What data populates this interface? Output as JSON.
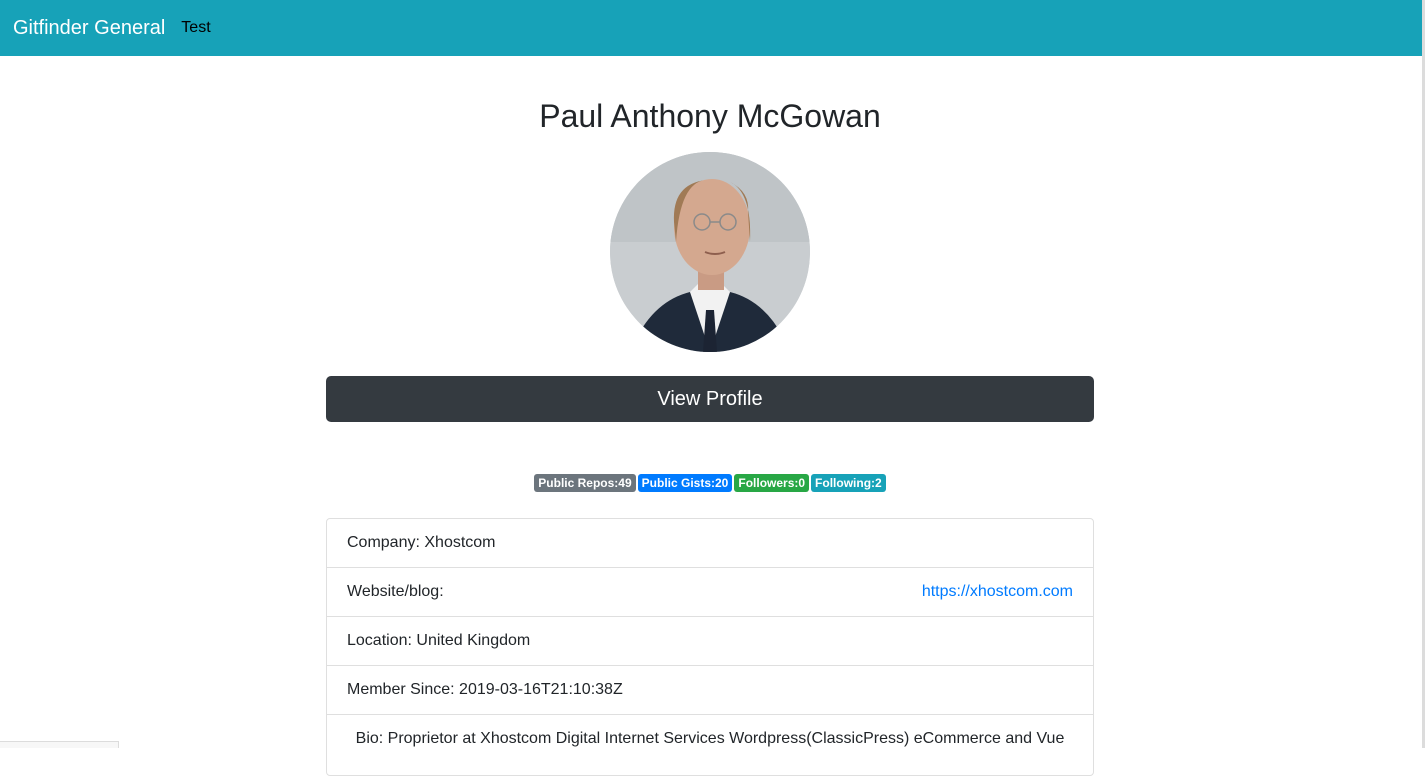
{
  "navbar": {
    "brand": "Gitfinder General",
    "links": [
      "Test"
    ],
    "color": "#17a2b8"
  },
  "profile": {
    "name": "Paul Anthony McGowan",
    "avatar_icon": "user-photo",
    "view_button": "View Profile"
  },
  "badges": {
    "repos": "Public Repos:49",
    "gists": "Public Gists:20",
    "followers": "Followers:0",
    "following": "Following:2"
  },
  "details": {
    "company": "Company: Xhostcom",
    "website_label": "Website/blog:",
    "website_url": "https://xhostcom.com",
    "location": "Location: United Kingdom",
    "member_since": "Member Since: 2019-03-16T21:10:38Z",
    "bio": "Bio: Proprietor at Xhostcom Digital Internet Services Wordpress(ClassicPress) eCommerce and Vue"
  }
}
